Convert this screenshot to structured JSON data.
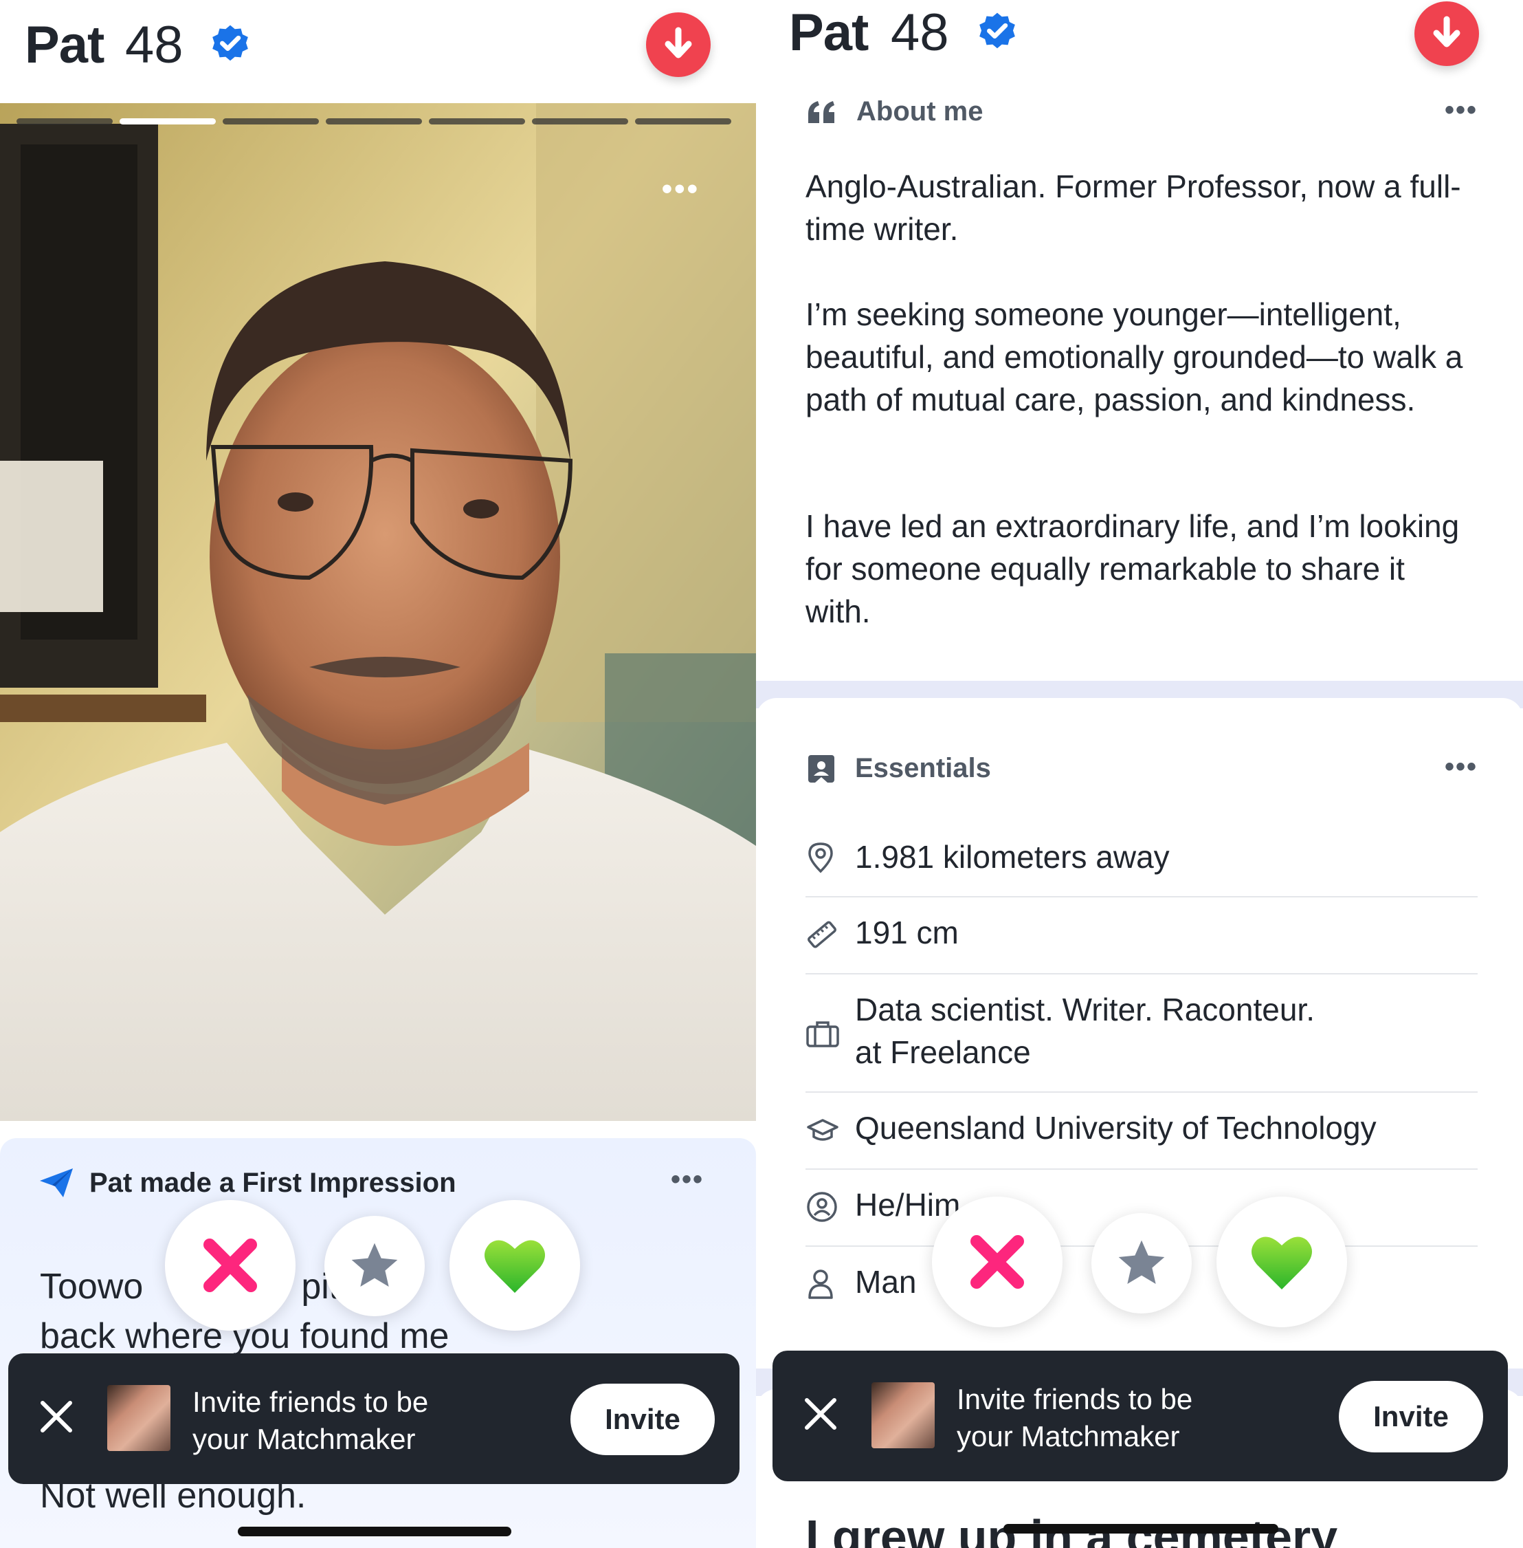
{
  "left": {
    "header": {
      "name": "Pat",
      "age": "48"
    },
    "photo_more": "•••",
    "progress": {
      "segments": 7,
      "active_index": 1
    },
    "first_impression": {
      "title": "Pat made a First Impression",
      "more": "•••",
      "text_line1_a": "Toowo",
      "text_line1_b": "pit",
      "text_line2": "back where you found me",
      "text_tail": "Not well enough."
    },
    "invite": {
      "line1": "Invite friends to be",
      "line2": "your Matchmaker",
      "button": "Invite"
    }
  },
  "right": {
    "header": {
      "name": "Pat",
      "age": "48"
    },
    "about": {
      "title": "About me",
      "more": "•••",
      "p1": "Anglo-Australian. Former Professor, now a full-time writer.",
      "p2": "I’m seeking someone younger—intelligent, beautiful, and emotionally grounded—to walk a path of mutual care, passion, and kindness.",
      "p3": "I have led an extraordinary life, and I’m looking for someone equally remarkable to share it with."
    },
    "essentials": {
      "title": "Essentials",
      "more": "•••",
      "distance": "1.981 kilometers away",
      "height": "191 cm",
      "job_line1": "Data scientist. Writer. Raconteur.",
      "job_line2": "at Freelance",
      "school": "Queensland University of Technology",
      "pronouns": "He/Him",
      "gender": "Man"
    },
    "invite": {
      "line1": "Invite friends to be",
      "line2": "your Matchmaker",
      "button": "Invite"
    },
    "tail_text": "I grew up in a cemetery"
  },
  "colors": {
    "accent_red": "#f0424f",
    "verified_blue": "#1a73e8",
    "nope_pink": "#fd267d",
    "like_green": "#5ed52d",
    "dark": "#21262e"
  },
  "icons": [
    "verified-badge-icon",
    "down-arrow-icon",
    "more-icon",
    "paper-plane-icon",
    "close-icon",
    "star-icon",
    "heart-icon",
    "quote-icon",
    "profile-card-icon",
    "location-pin-icon",
    "ruler-icon",
    "briefcase-icon",
    "graduation-cap-icon",
    "pronoun-icon",
    "person-icon"
  ]
}
